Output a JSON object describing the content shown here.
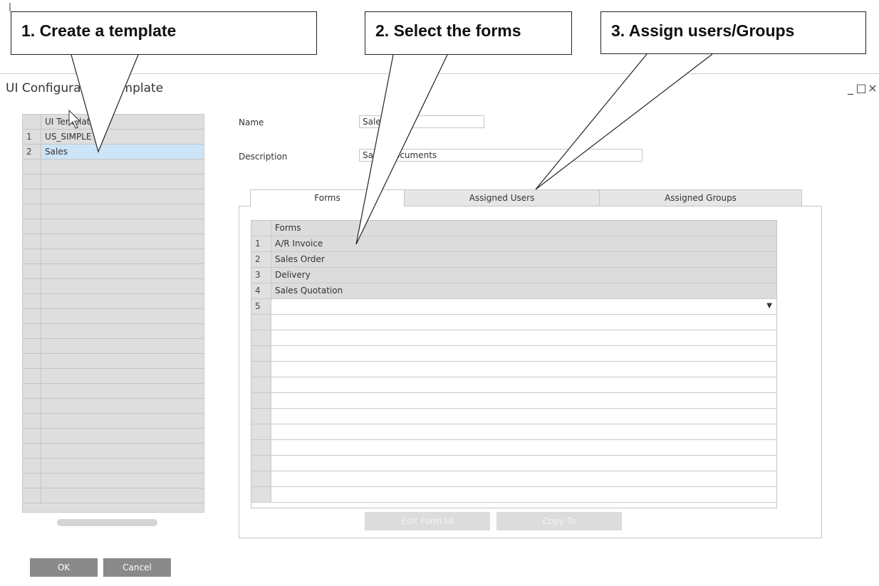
{
  "window": {
    "title": "UI Configuration Template",
    "controls": [
      "_",
      "□",
      "×"
    ]
  },
  "callouts": [
    {
      "text": "1. Create a template"
    },
    {
      "text": "2. Select the forms"
    },
    {
      "text": "3. Assign users/Groups"
    }
  ],
  "template_list": {
    "header": "UI Template",
    "rows": [
      {
        "num": "1",
        "value": "US_SIMPLE"
      },
      {
        "num": "2",
        "value": "Sales"
      }
    ]
  },
  "fields": {
    "name_label": "Name",
    "name_value": "Sales",
    "description_label": "Description",
    "description_value": "Sales Documents"
  },
  "tabs": [
    {
      "label": "Forms",
      "active": true
    },
    {
      "label": "Assigned Users",
      "active": false
    },
    {
      "label": "Assigned Groups",
      "active": false
    }
  ],
  "forms_grid": {
    "header": "Forms",
    "rows": [
      {
        "num": "1",
        "value": "A/R Invoice"
      },
      {
        "num": "2",
        "value": "Sales Order"
      },
      {
        "num": "3",
        "value": "Delivery"
      },
      {
        "num": "4",
        "value": "Sales Quotation"
      },
      {
        "num": "5",
        "value": ""
      }
    ]
  },
  "buttons": {
    "edit_form_ui": "Edit Form UI",
    "copy_to": "Copy To",
    "ok": "OK",
    "cancel": "Cancel"
  },
  "icons": {
    "dropdown": "dropdown-arrow-icon",
    "cursor": "mouse-pointer-icon"
  }
}
